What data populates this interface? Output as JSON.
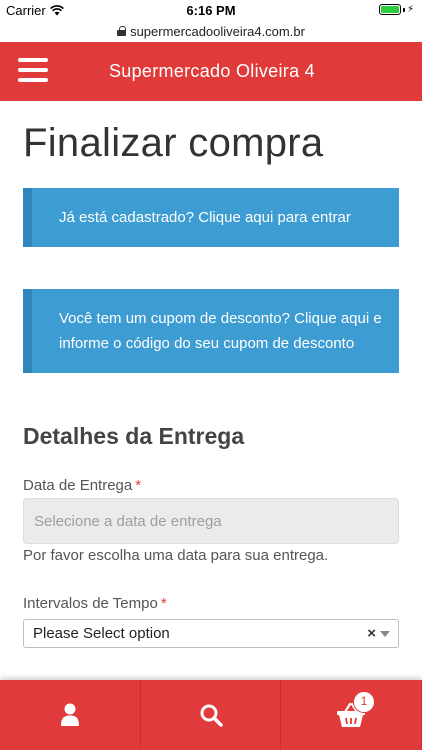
{
  "status_bar": {
    "carrier": "Carrier",
    "time": "6:16 PM"
  },
  "browser": {
    "url": "supermercadooliveira4.com.br"
  },
  "header": {
    "title": "Supermercado Oliveira 4",
    "menu_icon": "hamburger-menu-icon",
    "background_color": "#e03a3a"
  },
  "page": {
    "title": "Finalizar compra"
  },
  "notices": {
    "login": "Já está cadastrado? Clique aqui para entrar",
    "coupon": "Você tem um cupom de desconto? Clique aqui e informe o código do seu cupom de desconto",
    "color": "#3d9cd2"
  },
  "delivery": {
    "section_title": "Detalhes da Entrega",
    "date_label": "Data de Entrega",
    "required_mark": "*",
    "date_placeholder": "Selecione a data de entrega",
    "date_help": "Por favor escolha uma data para sua entrega.",
    "time_label": "Intervalos de Tempo",
    "time_selected": "Please Select option",
    "clear_symbol": "×"
  },
  "tab_bar": {
    "tabs": [
      {
        "icon": "user-icon"
      },
      {
        "icon": "search-icon"
      },
      {
        "icon": "shopping-basket-icon"
      }
    ],
    "cart_count": "1"
  }
}
